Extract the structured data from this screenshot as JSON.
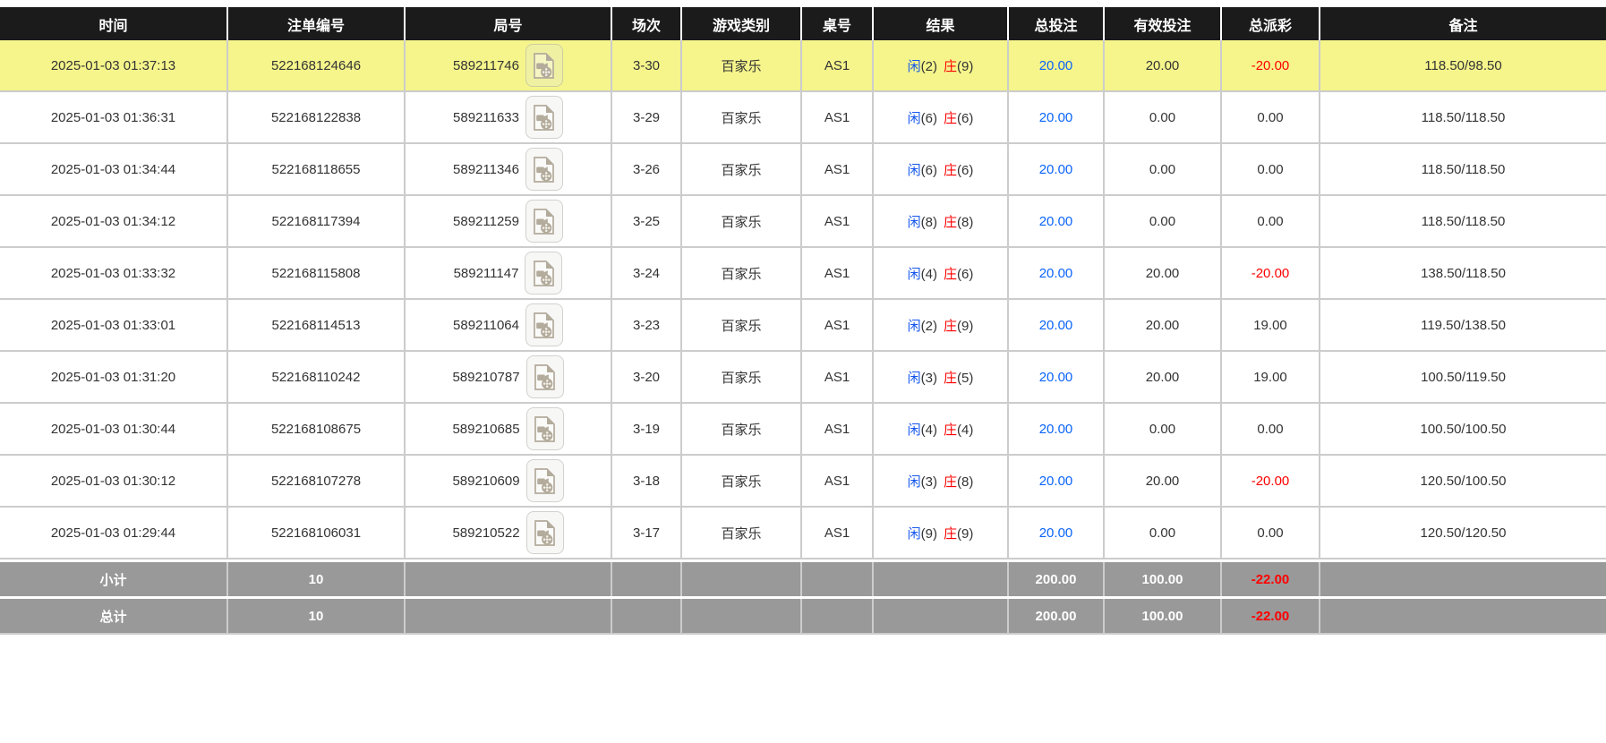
{
  "table": {
    "columns": [
      {
        "key": "time",
        "label": "时间"
      },
      {
        "key": "bet_id",
        "label": "注单编号"
      },
      {
        "key": "round_id",
        "label": "局号"
      },
      {
        "key": "session",
        "label": "场次"
      },
      {
        "key": "game_type",
        "label": "游戏类别"
      },
      {
        "key": "table_id",
        "label": "桌号"
      },
      {
        "key": "result",
        "label": "结果"
      },
      {
        "key": "total_bet",
        "label": "总投注"
      },
      {
        "key": "valid_bet",
        "label": "有效投注"
      },
      {
        "key": "payout",
        "label": "总派彩"
      },
      {
        "key": "remark",
        "label": "备注"
      }
    ],
    "rows": [
      {
        "highlighted": true,
        "time": "2025-01-03 01:37:13",
        "bet_id": "522168124646",
        "round_id": "589211746",
        "session": "3-30",
        "game_type": "百家乐",
        "table_id": "AS1",
        "result": {
          "player_label": "闲",
          "player_value": "(2)",
          "banker_label": "庄",
          "banker_value": "(9)"
        },
        "total_bet": "20.00",
        "valid_bet": "20.00",
        "payout": "-20.00",
        "remark": "118.50/98.50"
      },
      {
        "highlighted": false,
        "time": "2025-01-03 01:36:31",
        "bet_id": "522168122838",
        "round_id": "589211633",
        "session": "3-29",
        "game_type": "百家乐",
        "table_id": "AS1",
        "result": {
          "player_label": "闲",
          "player_value": "(6)",
          "banker_label": "庄",
          "banker_value": "(6)"
        },
        "total_bet": "20.00",
        "valid_bet": "0.00",
        "payout": "0.00",
        "remark": "118.50/118.50"
      },
      {
        "highlighted": false,
        "time": "2025-01-03 01:34:44",
        "bet_id": "522168118655",
        "round_id": "589211346",
        "session": "3-26",
        "game_type": "百家乐",
        "table_id": "AS1",
        "result": {
          "player_label": "闲",
          "player_value": "(6)",
          "banker_label": "庄",
          "banker_value": "(6)"
        },
        "total_bet": "20.00",
        "valid_bet": "0.00",
        "payout": "0.00",
        "remark": "118.50/118.50"
      },
      {
        "highlighted": false,
        "time": "2025-01-03 01:34:12",
        "bet_id": "522168117394",
        "round_id": "589211259",
        "session": "3-25",
        "game_type": "百家乐",
        "table_id": "AS1",
        "result": {
          "player_label": "闲",
          "player_value": "(8)",
          "banker_label": "庄",
          "banker_value": "(8)"
        },
        "total_bet": "20.00",
        "valid_bet": "0.00",
        "payout": "0.00",
        "remark": "118.50/118.50"
      },
      {
        "highlighted": false,
        "time": "2025-01-03 01:33:32",
        "bet_id": "522168115808",
        "round_id": "589211147",
        "session": "3-24",
        "game_type": "百家乐",
        "table_id": "AS1",
        "result": {
          "player_label": "闲",
          "player_value": "(4)",
          "banker_label": "庄",
          "banker_value": "(6)"
        },
        "total_bet": "20.00",
        "valid_bet": "20.00",
        "payout": "-20.00",
        "remark": "138.50/118.50"
      },
      {
        "highlighted": false,
        "time": "2025-01-03 01:33:01",
        "bet_id": "522168114513",
        "round_id": "589211064",
        "session": "3-23",
        "game_type": "百家乐",
        "table_id": "AS1",
        "result": {
          "player_label": "闲",
          "player_value": "(2)",
          "banker_label": "庄",
          "banker_value": "(9)"
        },
        "total_bet": "20.00",
        "valid_bet": "20.00",
        "payout": "19.00",
        "remark": "119.50/138.50"
      },
      {
        "highlighted": false,
        "time": "2025-01-03 01:31:20",
        "bet_id": "522168110242",
        "round_id": "589210787",
        "session": "3-20",
        "game_type": "百家乐",
        "table_id": "AS1",
        "result": {
          "player_label": "闲",
          "player_value": "(3)",
          "banker_label": "庄",
          "banker_value": "(5)"
        },
        "total_bet": "20.00",
        "valid_bet": "20.00",
        "payout": "19.00",
        "remark": "100.50/119.50"
      },
      {
        "highlighted": false,
        "time": "2025-01-03 01:30:44",
        "bet_id": "522168108675",
        "round_id": "589210685",
        "session": "3-19",
        "game_type": "百家乐",
        "table_id": "AS1",
        "result": {
          "player_label": "闲",
          "player_value": "(4)",
          "banker_label": "庄",
          "banker_value": "(4)"
        },
        "total_bet": "20.00",
        "valid_bet": "0.00",
        "payout": "0.00",
        "remark": "100.50/100.50"
      },
      {
        "highlighted": false,
        "time": "2025-01-03 01:30:12",
        "bet_id": "522168107278",
        "round_id": "589210609",
        "session": "3-18",
        "game_type": "百家乐",
        "table_id": "AS1",
        "result": {
          "player_label": "闲",
          "player_value": "(3)",
          "banker_label": "庄",
          "banker_value": "(8)"
        },
        "total_bet": "20.00",
        "valid_bet": "20.00",
        "payout": "-20.00",
        "remark": "120.50/100.50"
      },
      {
        "highlighted": false,
        "time": "2025-01-03 01:29:44",
        "bet_id": "522168106031",
        "round_id": "589210522",
        "session": "3-17",
        "game_type": "百家乐",
        "table_id": "AS1",
        "result": {
          "player_label": "闲",
          "player_value": "(9)",
          "banker_label": "庄",
          "banker_value": "(9)"
        },
        "total_bet": "20.00",
        "valid_bet": "0.00",
        "payout": "0.00",
        "remark": "120.50/120.50"
      }
    ],
    "footer": [
      {
        "label": "小计",
        "count": "10",
        "total_bet": "200.00",
        "valid_bet": "100.00",
        "payout": "-22.00"
      },
      {
        "label": "总计",
        "count": "10",
        "total_bet": "200.00",
        "valid_bet": "100.00",
        "payout": "-22.00"
      }
    ]
  },
  "icons": {
    "video_replay": "video-file-icon"
  },
  "colors": {
    "header_bg": "#1b1b1b",
    "highlight_yellow": "#f5f58c",
    "footer_bg": "#999999",
    "amount_blue": "#0a64fa",
    "player_blue": "#1557ec",
    "banker_red": "#fe0000",
    "negative_red": "#fe0000",
    "grid_line": "#cccccc",
    "body_text": "#333333"
  }
}
